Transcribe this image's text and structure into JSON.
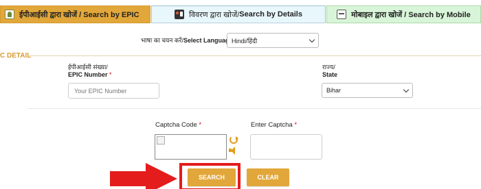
{
  "tabs": [
    {
      "label": "ईपीआईसी द्वारा खोजें / Search by EPIC",
      "icon": "epic-card-icon",
      "active": true
    },
    {
      "label_hi": "विवरण द्वारा खोजें/ ",
      "label_en": "Search by Details",
      "icon": "details-icon"
    },
    {
      "label": "मोबाइल द्वारा खोजें / Search by Mobile",
      "icon": "mobile-icon"
    }
  ],
  "language": {
    "label_hi": "भाषा का चयन करें/",
    "label_en": "Select Language",
    "selected": "Hindi/हिंदी"
  },
  "section": {
    "title": "C DETAIL"
  },
  "epic": {
    "label_hi": "ईपीआईसी संख्या/",
    "label_en": "EPIC Number",
    "required": "*",
    "placeholder": "Your EPIC Number"
  },
  "state": {
    "label_hi": "राज्य/",
    "label_en": "State",
    "selected": "Bihar"
  },
  "captcha": {
    "label": "Captcha Code",
    "required": "*",
    "enter_label": "Enter Captcha",
    "enter_required": "*"
  },
  "buttons": {
    "search": "SEARCH",
    "clear": "CLEAR"
  },
  "colors": {
    "accent": "#e2a73a",
    "highlight": "#e41c1c",
    "required": "#d0021b"
  }
}
